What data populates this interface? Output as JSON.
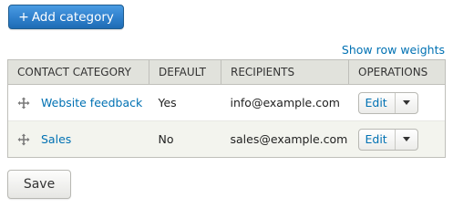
{
  "toolbar": {
    "add_category_label": "Add category",
    "add_icon_glyph": "+"
  },
  "table": {
    "show_row_weights_label": "Show row weights",
    "headers": [
      "Contact category",
      "Default",
      "Recipients",
      "Operations"
    ],
    "rows": [
      {
        "name": "Website feedback",
        "default": "Yes",
        "recipients": "info@example.com",
        "edit_label": "Edit"
      },
      {
        "name": "Sales",
        "default": "No",
        "recipients": "sales@example.com",
        "edit_label": "Edit"
      }
    ]
  },
  "footer": {
    "save_label": "Save"
  },
  "colors": {
    "primary_button": "#2f80cc",
    "link": "#0071b3",
    "header_background": "#e1e2dc",
    "striped_row": "#f3f4ee"
  },
  "icons": {
    "add": "plus-icon",
    "drag": "drag-handle-icon",
    "dropdown": "chevron-down-icon"
  }
}
